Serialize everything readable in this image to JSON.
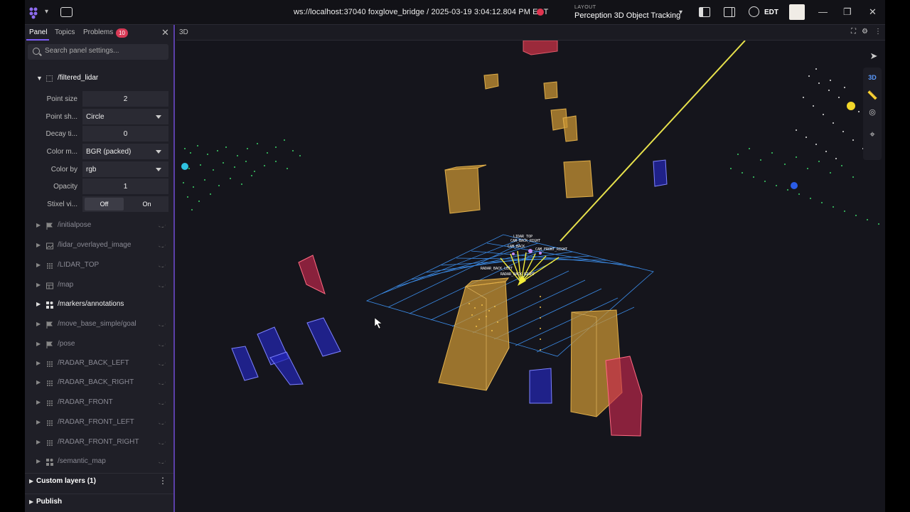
{
  "topbar": {
    "connection": "ws://localhost:37040 foxglove_bridge / 2025-03-19 3:04:12.804 PM EDT",
    "layout_caption": "LAYOUT",
    "layout_name": "Perception 3D Object Tracking",
    "timezone": "EDT"
  },
  "sidebar": {
    "tabs": [
      "Panel",
      "Topics",
      "Problems"
    ],
    "problems_count": "10",
    "search_placeholder": "Search panel settings...",
    "topic": "/filtered_lidar",
    "settings": [
      {
        "label": "Point size",
        "value": "2"
      },
      {
        "label": "Point sh...",
        "value": "Circle"
      },
      {
        "label": "Decay ti...",
        "value": "0"
      },
      {
        "label": "Color m...",
        "value": "BGR (packed)"
      },
      {
        "label": "Color by",
        "value": "rgb"
      },
      {
        "label": "Opacity",
        "value": "1"
      },
      {
        "label": "Stixel vi...",
        "off": "Off",
        "on": "On"
      }
    ],
    "tree": [
      "/initialpose",
      "/lidar_overlayed_image",
      "/LIDAR_TOP",
      "/map",
      "/markers/annotations",
      "/move_base_simple/goal",
      "/pose",
      "/RADAR_BACK_LEFT",
      "/RADAR_BACK_RIGHT",
      "/RADAR_FRONT",
      "/RADAR_FRONT_LEFT",
      "/RADAR_FRONT_RIGHT",
      "/semantic_map"
    ],
    "footer": [
      "Custom layers (1)",
      "Publish"
    ]
  },
  "panel3d": {
    "title": "3D",
    "mode": "3D",
    "frame_labels": [
      "CAM_BACK_RIGHT",
      "CAM_FRONT_RIGHT",
      "CAM_BACK",
      "RADAR_BACK_LEFT",
      "RADAR_BACK_RIGHT",
      "LIDAR_TOP"
    ]
  },
  "colors": {
    "accent": "#7c5cf6",
    "badge": "#d83a56",
    "grid": "#3b8ce8",
    "box_orange": "#c79333",
    "box_blue": "#2326b8",
    "box_red": "#c8284f",
    "lidar_green": "#3bd46a"
  }
}
